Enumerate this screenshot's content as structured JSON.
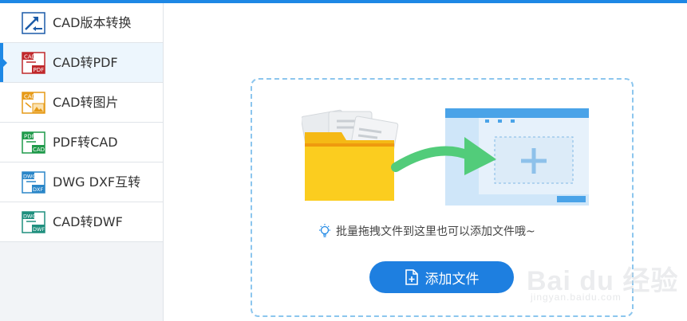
{
  "sidebar": {
    "items": [
      {
        "label": "CAD版本转换",
        "icon": "cad-version-convert-icon",
        "icon_text_top": "",
        "icon_text_bottom": "",
        "color": "#1a5aa8"
      },
      {
        "label": "CAD转PDF",
        "icon": "cad-to-pdf-icon",
        "icon_text_top": "CAD",
        "icon_text_bottom": "PDF",
        "color": "#c0282b"
      },
      {
        "label": "CAD转图片",
        "icon": "cad-to-image-icon",
        "icon_text_top": "CAD",
        "icon_text_bottom": "",
        "color": "#e69a17"
      },
      {
        "label": "PDF转CAD",
        "icon": "pdf-to-cad-icon",
        "icon_text_top": "PDF",
        "icon_text_bottom": "CAD",
        "color": "#1f9a4a"
      },
      {
        "label": "DWG DXF互转",
        "icon": "dwg-dxf-convert-icon",
        "icon_text_top": "DWG",
        "icon_text_bottom": "DXF",
        "color": "#2a86c8"
      },
      {
        "label": "CAD转DWF",
        "icon": "cad-to-dwf-icon",
        "icon_text_top": "DWG",
        "icon_text_bottom": "DWF",
        "color": "#1f8f7e"
      }
    ],
    "active_index": 1
  },
  "main": {
    "hint": "批量拖拽文件到这里也可以添加文件哦~",
    "add_button_label": "添加文件"
  },
  "colors": {
    "accent": "#1e88e5",
    "button": "#1e7fe0",
    "folder": "#f7c21a",
    "arrow": "#52cc7a",
    "window_bar": "#4aa3e8"
  },
  "watermark": {
    "logo": "Bai du 经验",
    "url": "jingyan.baidu.com"
  }
}
